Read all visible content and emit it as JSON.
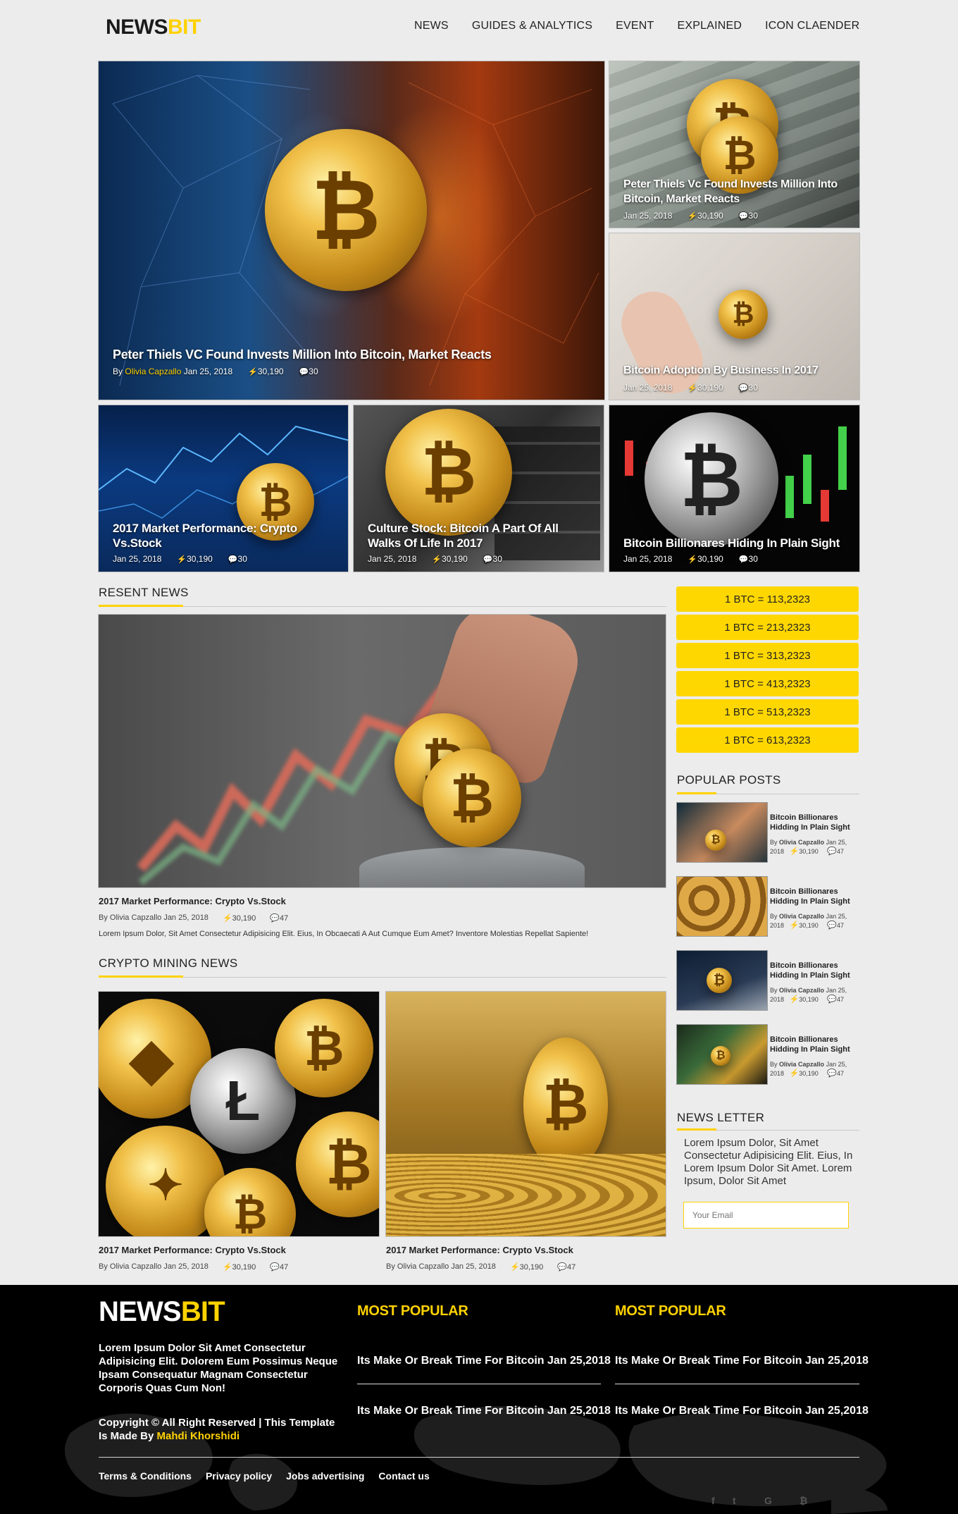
{
  "header": {
    "logo_a": "NEWS",
    "logo_b": "BIT",
    "nav": [
      "NEWS",
      "GUIDES & ANALYTICS",
      "EVENT",
      "EXPLAINED",
      "ICON CLAENDER"
    ]
  },
  "hero": {
    "main": {
      "title": "Peter Thiels VC Found Invests Million Into Bitcoin, Market Reacts",
      "by": "By",
      "author": "Olivia Capzallo",
      "date": "Jan 25, 2018",
      "views": "30,190",
      "comments": "30"
    },
    "right_top": {
      "title": "Peter Thiels Vc Found Invests Million Into Bitcoin, Market Reacts",
      "date": "Jan 25, 2018",
      "views": "30,190",
      "comments": "30"
    },
    "right_bottom": {
      "title": "Bitcoin Adoption By Business In 2017",
      "date": "Jan 25, 2018",
      "views": "30,190",
      "comments": "30"
    },
    "row": [
      {
        "title": "2017 Market Performance: Crypto Vs.Stock",
        "date": "Jan 25, 2018",
        "views": "30,190",
        "comments": "30"
      },
      {
        "title": "Culture Stock: Bitcoin A Part Of All Walks Of Life In 2017",
        "date": "Jan 25, 2018",
        "views": "30,190",
        "comments": "30"
      },
      {
        "title": "Bitcoin Billionares Hiding In Plain Sight",
        "date": "Jan 25, 2018",
        "views": "30,190",
        "comments": "30"
      }
    ]
  },
  "recent": {
    "heading": "RESENT NEWS",
    "title": "2017 Market Performance: Crypto Vs.Stock",
    "meta": "By Olivia Capzallo Jan 25, 2018",
    "views": "30,190",
    "comments": "47",
    "desc": "Lorem Ipsum Dolor, Sit Amet Consectetur Adipisicing Elit. Eius, In Obcaecati A Aut Cumque Eum Amet? Inventore Molestias Repellat Sapiente!"
  },
  "mining": {
    "heading": "CRYPTO MINING NEWS",
    "items": [
      {
        "title": "2017 Market Performance: Crypto Vs.Stock",
        "meta": "By Olivia Capzallo Jan 25, 2018",
        "views": "30,190",
        "comments": "47"
      },
      {
        "title": "2017 Market Performance: Crypto Vs.Stock",
        "meta": "By Olivia Capzallo Jan 25, 2018",
        "views": "30,190",
        "comments": "47"
      }
    ]
  },
  "rates": [
    "1 BTC = 113,2323",
    "1 BTC = 213,2323",
    "1 BTC = 313,2323",
    "1 BTC = 413,2323",
    "1 BTC = 513,2323",
    "1 BTC = 613,2323"
  ],
  "popular": {
    "heading": "POPULAR POSTS",
    "items": [
      {
        "title": "Bitcoin Billionares Hidding In Plain Sight",
        "by": "By",
        "author": "Olivia Capzallo",
        "date1": "Jan 25,",
        "date2": "2018",
        "views": "30,190",
        "comments": "47"
      },
      {
        "title": "Bitcoin Billionares Hidding In Plain Sight",
        "by": "By",
        "author": "Olivia Capzallo",
        "date1": "Jan 25,",
        "date2": "2018",
        "views": "30,190",
        "comments": "47"
      },
      {
        "title": "Bitcoin Billionares Hidding In Plain Sight",
        "by": "By",
        "author": "Olivia Capzallo",
        "date1": "Jan 25,",
        "date2": "2018",
        "views": "30,190",
        "comments": "47"
      },
      {
        "title": "Bitcoin Billionares Hidding In Plain Sight",
        "by": "By",
        "author": "Olivia Capzallo",
        "date1": "Jan 25,",
        "date2": "2018",
        "views": "30,190",
        "comments": "47"
      }
    ]
  },
  "newsletter": {
    "heading": "NEWS LETTER",
    "text": "Lorem Ipsum Dolor, Sit Amet Consectetur Adipisicing Elit. Eius, In Lorem Ipsum Dolor Sit Amet. Lorem Ipsum, Dolor Sit Amet",
    "placeholder": "Your Email"
  },
  "footer": {
    "logo_a": "NEWS",
    "logo_b": "BIT",
    "desc": "Lorem Ipsum Dolor Sit Amet Consectetur Adipisicing Elit. Dolorem Eum Possimus Neque Ipsam Consequatur Magnam Consectetur Corporis Quas Cum Non!",
    "copy": "Copyright © All Right Reserved | This Template Is Made By ",
    "author": "Mahdi Khorshidi",
    "col1_heading": "MOST POPULAR",
    "col2_heading": "MOST POPULAR",
    "link": "Its Make Or Break Time For Bitcoin Jan 25,2018",
    "bottom_links": [
      "Terms & Conditions",
      "Privacy policy",
      "Jobs advertising",
      "Contact us"
    ],
    "social": [
      "f",
      "t",
      "G",
      "₿"
    ]
  },
  "colors": {
    "accent": "#ffd200",
    "background": "#ececec",
    "footer": "#000000"
  }
}
